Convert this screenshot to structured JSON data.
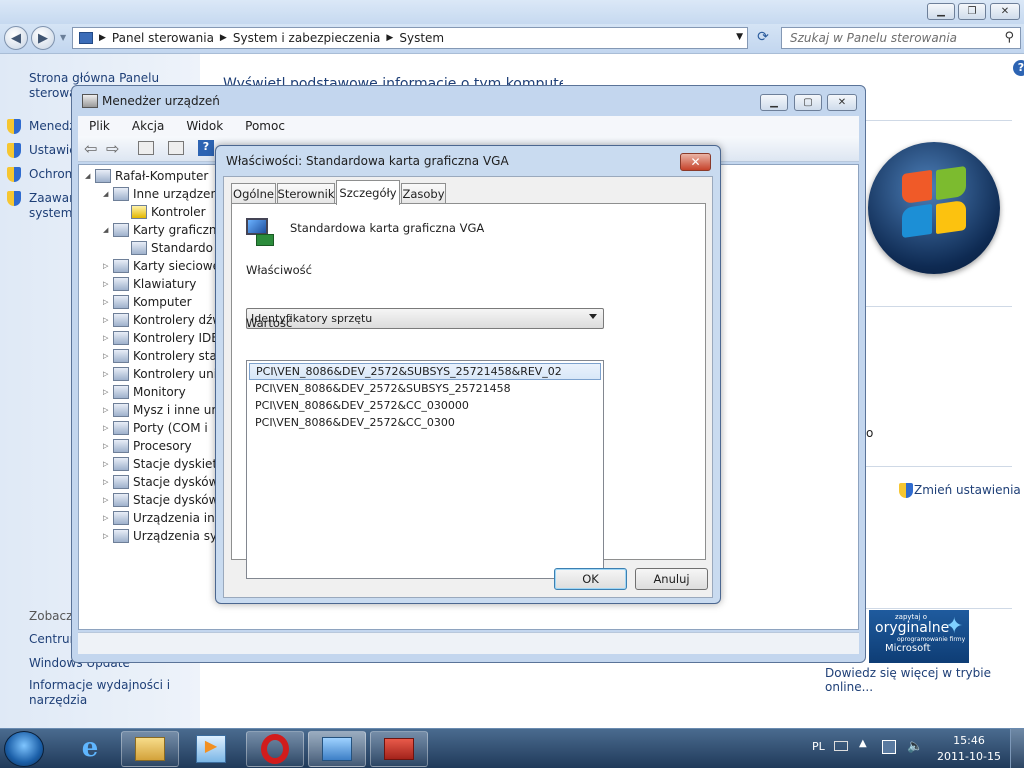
{
  "control_panel": {
    "address": {
      "segments": [
        "Panel sterowania",
        "System i zabezpieczenia",
        "System"
      ]
    },
    "search_placeholder": "Szukaj w Panelu sterowania",
    "left_links": {
      "home": "Strona główna Panelu sterowania",
      "device_manager": "Menedż",
      "settings": "Ustawie",
      "protection": "Ochrona",
      "advanced": "Zaawan systemu",
      "see_also": "Zobacz",
      "center": "Centrum",
      "windows_update": "Windows Update",
      "perf": "Informacje wydajności i narzędzia"
    },
    "heading_partial": "Wyświetl podstawowe informacje o tym komputerze",
    "change_settings": "Zmień ustawienia",
    "ask_genuine": {
      "line1": "zapytaj o",
      "line2": "oryginalne",
      "line3": "oprogramowanie firmy",
      "line4": "Microsoft"
    },
    "learn_more": "Dowiedz się więcej w trybie online...",
    "partial_o": "o"
  },
  "device_manager": {
    "title": "Menedżer urządzeń",
    "menu": [
      "Plik",
      "Akcja",
      "Widok",
      "Pomoc"
    ],
    "tree": [
      {
        "label": "Rafał-Komputer",
        "level": 0,
        "expanded": true
      },
      {
        "label": "Inne urządzen",
        "level": 1,
        "expanded": true
      },
      {
        "label": "Kontroler",
        "level": 2,
        "warning": true
      },
      {
        "label": "Karty graficzn",
        "level": 1,
        "expanded": true
      },
      {
        "label": "Standardo",
        "level": 2
      },
      {
        "label": "Karty sieciowe",
        "level": 1
      },
      {
        "label": "Klawiatury",
        "level": 1
      },
      {
        "label": "Komputer",
        "level": 1
      },
      {
        "label": "Kontrolery dźw",
        "level": 1
      },
      {
        "label": "Kontrolery IDE",
        "level": 1
      },
      {
        "label": "Kontrolery sta",
        "level": 1
      },
      {
        "label": "Kontrolery uni",
        "level": 1
      },
      {
        "label": "Monitory",
        "level": 1
      },
      {
        "label": "Mysz i inne ur",
        "level": 1
      },
      {
        "label": "Porty (COM i",
        "level": 1
      },
      {
        "label": "Procesory",
        "level": 1
      },
      {
        "label": "Stacje dyskiet",
        "level": 1
      },
      {
        "label": "Stacje dysków",
        "level": 1
      },
      {
        "label": "Stacje dysków",
        "level": 1
      },
      {
        "label": "Urządzenia int",
        "level": 1
      },
      {
        "label": "Urządzenia sy",
        "level": 1
      }
    ]
  },
  "properties_dialog": {
    "title": "Właściwości: Standardowa karta graficzna VGA",
    "tabs": [
      "Ogólne",
      "Sterownik",
      "Szczegóły",
      "Zasoby"
    ],
    "active_tab": "Szczegóły",
    "device_name": "Standardowa karta graficzna VGA",
    "property_label": "Właściwość",
    "property_value": "Identyfikatory sprzętu",
    "value_label": "Wartość",
    "values": [
      "PCI\\VEN_8086&DEV_2572&SUBSYS_25721458&REV_02",
      "PCI\\VEN_8086&DEV_2572&SUBSYS_25721458",
      "PCI\\VEN_8086&DEV_2572&CC_030000",
      "PCI\\VEN_8086&DEV_2572&CC_0300"
    ],
    "ok": "OK",
    "cancel": "Anuluj"
  },
  "taskbar": {
    "lang": "PL",
    "time": "15:46",
    "date": "2011-10-15"
  }
}
